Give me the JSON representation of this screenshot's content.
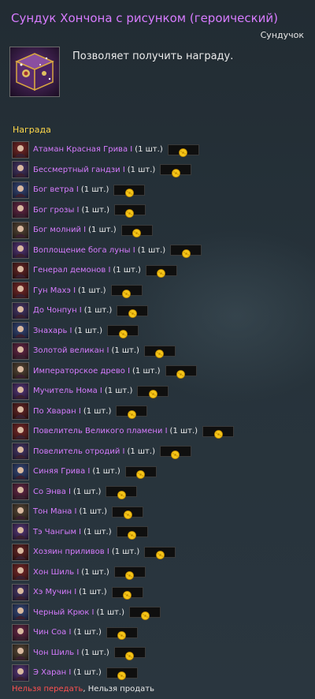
{
  "title": "Сундук Хончона с рисунком (героический)",
  "subtitle": "Сундучок",
  "description": "Позволяет получить награду.",
  "icon": "treasure-chest-icon",
  "reward_section_label": "Награда",
  "rewards": [
    {
      "name": "Атаман Красная Грива I",
      "qty": "(1 шт.)"
    },
    {
      "name": "Бессмертный гандзи I",
      "qty": "(1 шт.)"
    },
    {
      "name": "Бог ветра I",
      "qty": "(1 шт.)"
    },
    {
      "name": "Бог грозы I",
      "qty": "(1 шт.)"
    },
    {
      "name": "Бог молний I",
      "qty": "(1 шт.)"
    },
    {
      "name": "Воплощение бога луны I",
      "qty": "(1 шт.)"
    },
    {
      "name": "Генерал демонов I",
      "qty": "(1 шт.)"
    },
    {
      "name": "Гун Махэ I",
      "qty": "(1 шт.)"
    },
    {
      "name": "До Чонпун I",
      "qty": "(1 шт.)"
    },
    {
      "name": "Знахарь I",
      "qty": "(1 шт.)"
    },
    {
      "name": "Золотой великан I",
      "qty": "(1 шт.)"
    },
    {
      "name": "Императорское древо I",
      "qty": "(1 шт.)"
    },
    {
      "name": "Мучитель Нома I",
      "qty": "(1 шт.)"
    },
    {
      "name": "По Хваран I",
      "qty": "(1 шт.)"
    },
    {
      "name": "Повелитель Великого пламени I",
      "qty": "(1 шт.)"
    },
    {
      "name": "Повелитель отродий I",
      "qty": "(1 шт.)"
    },
    {
      "name": "Синяя Грива I",
      "qty": "(1 шт.)"
    },
    {
      "name": "Со Энва I",
      "qty": "(1 шт.)"
    },
    {
      "name": "Тон Мана I",
      "qty": "(1 шт.)"
    },
    {
      "name": "Тэ Чангым I",
      "qty": "(1 шт.)"
    },
    {
      "name": "Хозяин приливов I",
      "qty": "(1 шт.)"
    },
    {
      "name": "Хон Шиль I",
      "qty": "(1 шт.)"
    },
    {
      "name": "Хэ Мучин I",
      "qty": "(1 шт.)"
    },
    {
      "name": "Черный Крюк I",
      "qty": "(1 шт.)"
    },
    {
      "name": "Чин Соа I",
      "qty": "(1 шт.)"
    },
    {
      "name": "Чон Шиль I",
      "qty": "(1 шт.)"
    },
    {
      "name": "Э Харан I",
      "qty": "(1 шт.)"
    }
  ],
  "footer": {
    "no_trade": "Нельзя передать",
    "separator": ", ",
    "no_sell": "Нельзя продать"
  },
  "colors": {
    "title": "#d77bff",
    "reward_name": "#d77bff",
    "section_label": "#ffd84a",
    "no_trade": "#ff5050",
    "coin": "#f5c518"
  }
}
